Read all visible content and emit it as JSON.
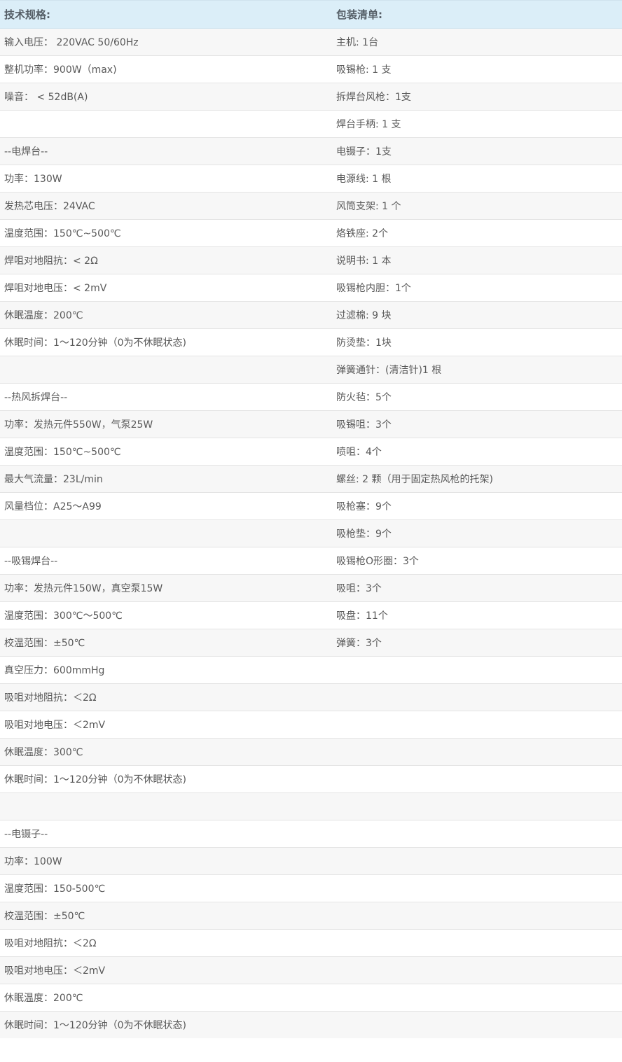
{
  "headers": {
    "specs": "技术规格:",
    "packing": "包装清单:"
  },
  "rows": [
    [
      "输入电压： 220VAC 50/60Hz",
      "主机: 1台"
    ],
    [
      "整机功率：900W（max)",
      "吸锡枪: 1 支"
    ],
    [
      "噪音： < 52dB(A)",
      "拆焊台风枪：1支"
    ],
    [
      "",
      "焊台手柄: 1 支"
    ],
    [
      "--电焊台--",
      "电镊子：1支"
    ],
    [
      "功率：130W",
      "电源线: 1 根"
    ],
    [
      "发热芯电压：24VAC",
      "风筒支架: 1 个"
    ],
    [
      "温度范围：150℃~500℃",
      "烙铁座: 2个"
    ],
    [
      "焊咀对地阻抗：< 2Ω",
      "说明书: 1 本"
    ],
    [
      "焊咀对地电压：< 2mV",
      "吸锡枪内胆：1个"
    ],
    [
      "休眠温度：200℃",
      "过滤棉: 9 块"
    ],
    [
      "休眠时间：1～120分钟（0为不休眠状态)",
      "防烫垫：1块"
    ],
    [
      "",
      "弹簧通针：(清洁针)1 根"
    ],
    [
      "--热风拆焊台--",
      "防火毡：5个"
    ],
    [
      "功率：发热元件550W，气泵25W",
      "吸锡咀：3个"
    ],
    [
      "温度范围：150℃~500℃",
      "喷咀：4个"
    ],
    [
      "最大气流量：23L/min",
      "螺丝: 2 颗（用于固定热风枪的托架)"
    ],
    [
      "风量档位：A25～A99",
      "吸枪塞：9个"
    ],
    [
      "",
      "吸枪垫：9个"
    ],
    [
      "--吸锡焊台--",
      "吸锡枪O形圈：3个"
    ],
    [
      "功率：发热元件150W，真空泵15W",
      "吸咀：3个"
    ],
    [
      "温度范围：300℃～500℃",
      "吸盘：11个"
    ],
    [
      "校温范围：±50℃",
      "弹簧：3个"
    ],
    [
      "真空压力：600mmHg",
      ""
    ],
    [
      "吸咀对地阻抗：＜2Ω",
      ""
    ],
    [
      "吸咀对地电压：＜2mV",
      ""
    ],
    [
      "休眠温度：300℃",
      ""
    ],
    [
      "休眠时间：1～120分钟（0为不休眠状态)",
      ""
    ],
    [
      "",
      ""
    ],
    [
      "--电镊子--",
      ""
    ],
    [
      "功率：100W",
      ""
    ],
    [
      "温度范围：150-500℃",
      ""
    ],
    [
      "校温范围：±50℃",
      ""
    ],
    [
      "吸咀对地阻抗：＜2Ω",
      ""
    ],
    [
      "吸咀对地电压：＜2mV",
      ""
    ],
    [
      "休眠温度：200℃",
      ""
    ],
    [
      "休眠时间：1～120分钟（0为不休眠状态)",
      ""
    ]
  ]
}
